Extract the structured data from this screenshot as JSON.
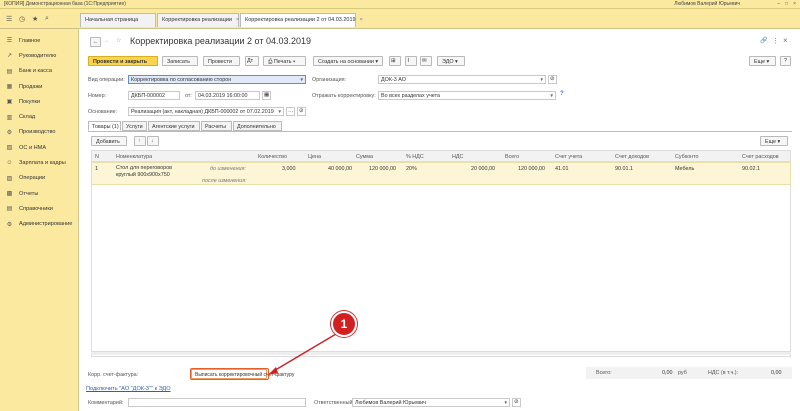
{
  "window": {
    "title": "[КОПИЯ] Демонстрационная база  (1С:Предприятие)",
    "user": "Любимов Валерий Юрьевич"
  },
  "tabs": [
    {
      "label": "Начальная страница"
    },
    {
      "label": "Корректировка реализации",
      "close": "×"
    },
    {
      "label": "Корректировка реализации 2 от 04.03.2019",
      "close": "×"
    }
  ],
  "sidebar": {
    "items": [
      {
        "label": "Главное",
        "icon": "☰"
      },
      {
        "label": "Руководителю",
        "icon": "↗"
      },
      {
        "label": "Банк и касса",
        "icon": "▤"
      },
      {
        "label": "Продажи",
        "icon": "▦"
      },
      {
        "label": "Покупки",
        "icon": "▣"
      },
      {
        "label": "Склад",
        "icon": "▥"
      },
      {
        "label": "Производство",
        "icon": "⚙"
      },
      {
        "label": "ОС и НМА",
        "icon": "▧"
      },
      {
        "label": "Зарплата и кадры",
        "icon": "☺"
      },
      {
        "label": "Операции",
        "icon": "▨"
      },
      {
        "label": "Отчеты",
        "icon": "▩"
      },
      {
        "label": "Справочники",
        "icon": "▤"
      },
      {
        "label": "Администрирование",
        "icon": "⚙"
      }
    ]
  },
  "doc": {
    "title": "Корректировка реализации 2 от 04.03.2019",
    "nav_back": "←",
    "nav_forward": "→",
    "link_icon": "🔗",
    "more": "⋮",
    "close": "×"
  },
  "toolbar": {
    "post_close": "Провести и закрыть",
    "save": "Записать",
    "post": "Провести",
    "print": "Печать",
    "create_based": "Создать на основании",
    "edo": "ЭДО",
    "more": "Еще",
    "help": "?"
  },
  "form": {
    "op_label": "Вид операции:",
    "op_value": "Корректировка по согласованию сторон",
    "org_label": "Организация:",
    "org_value": "ДОК-3 АО",
    "num_label": "Номер:",
    "num_value": "ДКБП-000002",
    "date_label": "от:",
    "date_value": "04.03.2019 16:00:00",
    "reflect_label": "Отражать корректировку:",
    "reflect_value": "Во всех разделах учета",
    "basis_label": "Основание:",
    "basis_value": "Реализация (акт, накладная) ДКБП-000002 от 07.02.2019"
  },
  "subtabs": [
    {
      "label": "Товары (1)"
    },
    {
      "label": "Услуги"
    },
    {
      "label": "Агентские услуги"
    },
    {
      "label": "Расчеты"
    },
    {
      "label": "Дополнительно"
    }
  ],
  "grid_toolbar": {
    "add": "Добавить",
    "up": "↑",
    "down": "↓",
    "more": "Еще"
  },
  "table": {
    "headers": [
      "N",
      "Номенклатура",
      "Количество",
      "Цена",
      "Сумма",
      "% НДС",
      "НДС",
      "Всего",
      "Счет учета",
      "Счет доходов",
      "Субконто",
      "Счет расходов"
    ],
    "row": {
      "n": "1",
      "name1": "Стол для переговоров",
      "name2": "круглый 900х900х750",
      "before": "до изменения:",
      "after": "после изменения:",
      "qty": "3,000",
      "price": "40 000,00",
      "sum": "120 000,00",
      "vat_rate": "20%",
      "vat": "20 000,00",
      "total": "120 000,00",
      "account": "41.01",
      "income": "90.01.1",
      "subconto": "Мебель",
      "expense": "90.02.1"
    }
  },
  "footer": {
    "invoice_label": "Корр. счет-фактура:",
    "invoice_button": "Выписать корректировочный счет-фактуру",
    "edo_link": "Подключить \"АО \"ДОК-3\"\" к ЭДО",
    "total_label": "Всего:",
    "total_value": "0,00",
    "currency": "руб",
    "vat_label": "НДС (в т.ч.):",
    "vat_value": "0,00",
    "comment_label": "Комментарий:",
    "responsible_label": "Ответственный:",
    "responsible_value": "Любимов Валерий Юрьевич"
  },
  "callout": {
    "number": "1"
  },
  "colors": {
    "accent": "#fbd44d",
    "sidebar": "#fbe9a0",
    "callout": "#d21f1f",
    "selection": "#dfe9f8"
  }
}
